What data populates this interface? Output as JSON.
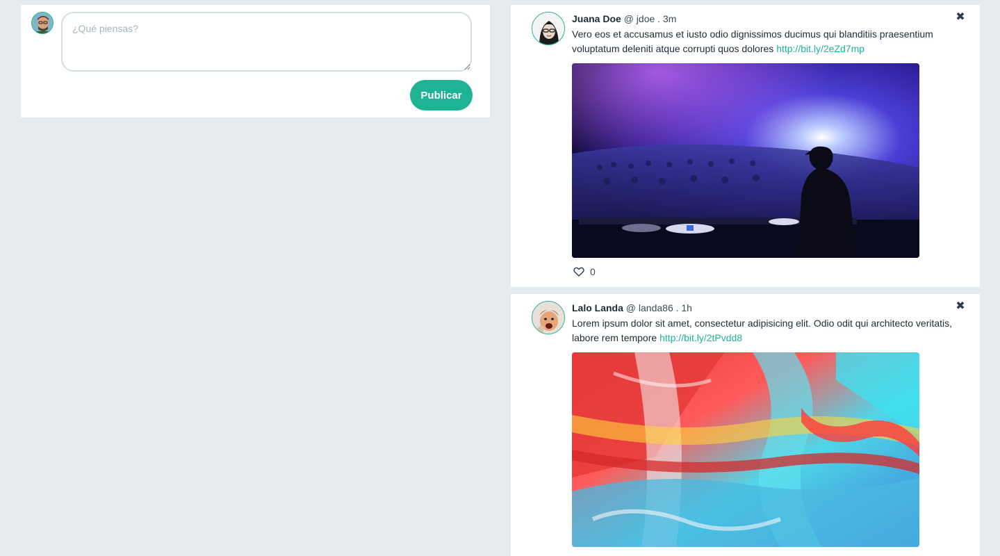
{
  "composer": {
    "placeholder": "¿Qué piensas?",
    "publish_label": "Publicar"
  },
  "posts": [
    {
      "name": "Juana Doe",
      "handle": "@ jdoe . 3m",
      "text": "Vero eos et accusamus et iusto odio dignissimos ducimus qui blanditiis praesentium voluptatum deleniti atque corrupti quos dolores ",
      "link": "http://bit.ly/2eZd7mp",
      "likes": "0",
      "image": "concert-dj-photo"
    },
    {
      "name": "Lalo Landa",
      "handle": "@ landa86 . 1h",
      "text": "Lorem ipsum dolor sit amet, consectetur adipisicing elit. Odio odit qui architecto veritatis, labore rem tempore ",
      "link": "http://bit.ly/2tPvdd8",
      "image": "abstract-paint-photo"
    }
  ],
  "icons": {
    "close": "close-icon",
    "heart": "heart-icon"
  },
  "colors": {
    "accent": "#1db394",
    "background": "#e6ebef",
    "card": "#ffffff",
    "text": "#1f2b36"
  }
}
